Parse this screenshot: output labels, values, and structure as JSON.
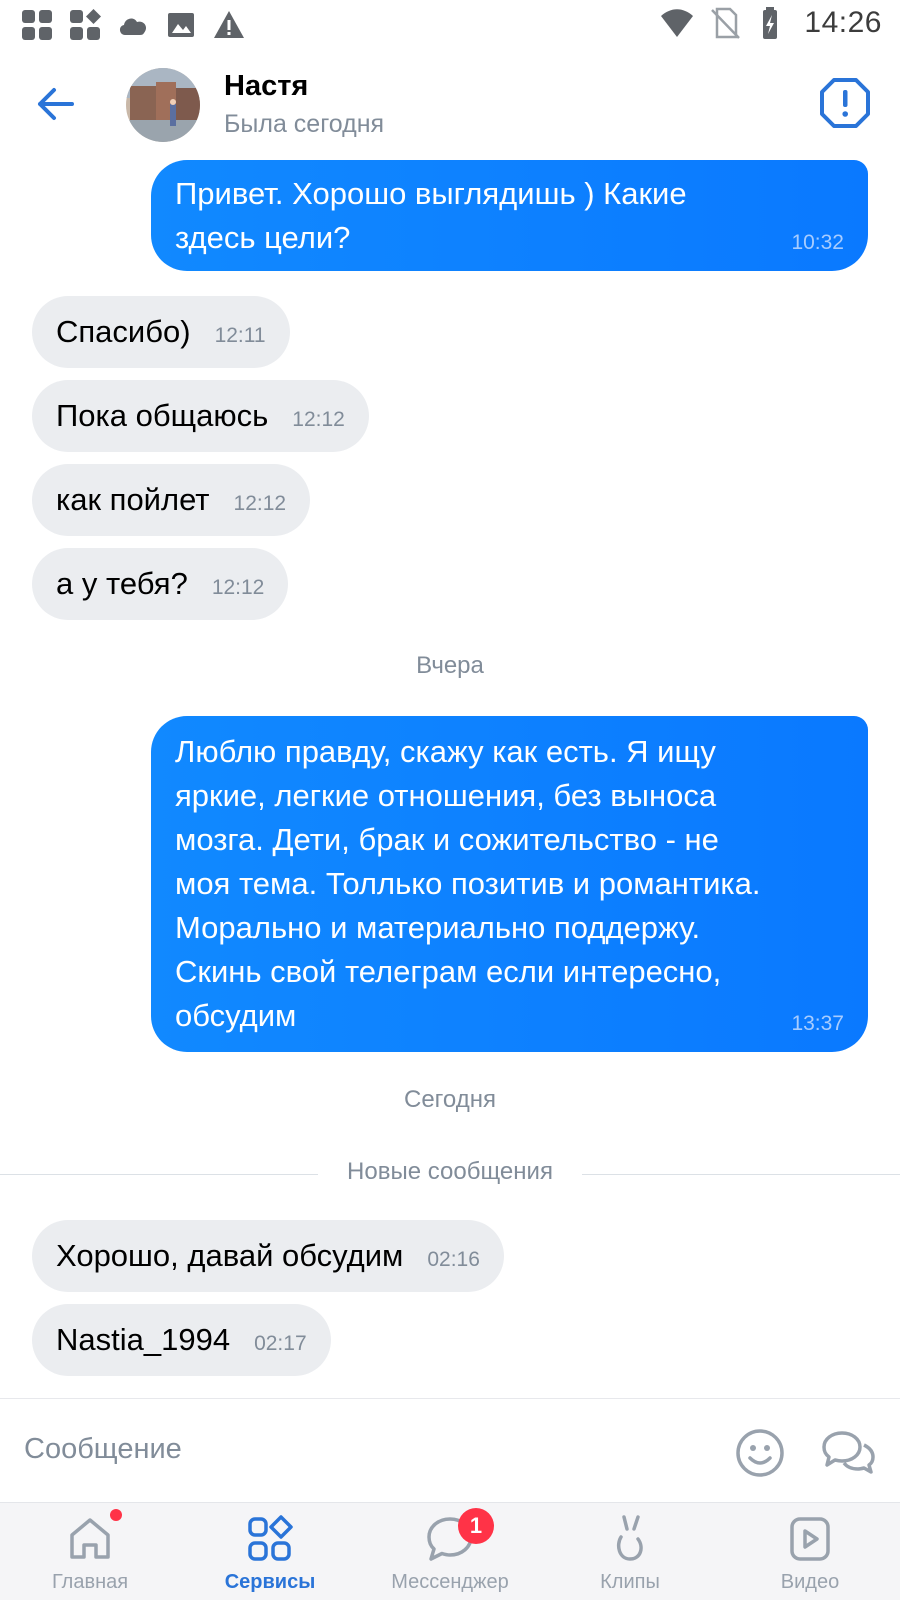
{
  "status_bar": {
    "time": "14:26",
    "left_icons": [
      "apps-icon",
      "widgets-icon",
      "cloud-icon",
      "image-icon",
      "warning-icon"
    ],
    "right_icons": [
      "wifi-icon",
      "no-sim-icon",
      "battery-charging-icon"
    ]
  },
  "header": {
    "contact_name": "Настя",
    "contact_status": "Была сегодня",
    "back_icon": "arrow-left-icon",
    "report_icon": "alert-octagon-icon"
  },
  "messages": [
    {
      "direction": "out",
      "text": "Привет. Хорошо выглядишь ) Какие\nздесь цели?",
      "time": "10:32"
    },
    {
      "direction": "in",
      "text": "Спасибо)",
      "time": "12:11"
    },
    {
      "direction": "in",
      "text": "Пока общаюсь",
      "time": "12:12"
    },
    {
      "direction": "in",
      "text": "как пойлет",
      "time": "12:12"
    },
    {
      "direction": "in",
      "text": "а у тебя?",
      "time": "12:12"
    },
    {
      "direction": "out",
      "text": "Люблю правду, скажу как есть. Я ищу\nяркие, легкие отношения, без выноса\nмозга. Дети, брак и сожительство - не\nмоя тема. Толлько позитив и романтика.\nМорально и материально поддержу.\nСкинь свой телеграм если интересно,\nобсудим",
      "time": "13:37"
    },
    {
      "direction": "in",
      "text": "Хорошо, давай обсудим",
      "time": "02:16"
    },
    {
      "direction": "in",
      "text": "Nastia_1994",
      "time": "02:17"
    }
  ],
  "separators": {
    "yesterday": "Вчера",
    "today": "Сегодня",
    "new_messages": "Новые сообщения"
  },
  "composer": {
    "placeholder": "Сообщение",
    "emoji_icon": "smile-icon",
    "voice_icon": "chat-bubbles-icon"
  },
  "bottom_nav": {
    "items": [
      {
        "label": "Главная",
        "icon": "home-icon",
        "active": false,
        "dot": true
      },
      {
        "label": "Сервисы",
        "icon": "services-grid-icon",
        "active": true
      },
      {
        "label": "Мессенджер",
        "icon": "messenger-icon",
        "active": false,
        "badge": "1"
      },
      {
        "label": "Клипы",
        "icon": "clips-icon",
        "active": false
      },
      {
        "label": "Видео",
        "icon": "video-icon",
        "active": false
      }
    ]
  },
  "colors": {
    "accent": "#2a74d8",
    "outgoing_bubble": "#0a79ff",
    "incoming_bubble": "#ebedf0",
    "secondary_text": "#818c99",
    "badge": "#ff3347"
  }
}
